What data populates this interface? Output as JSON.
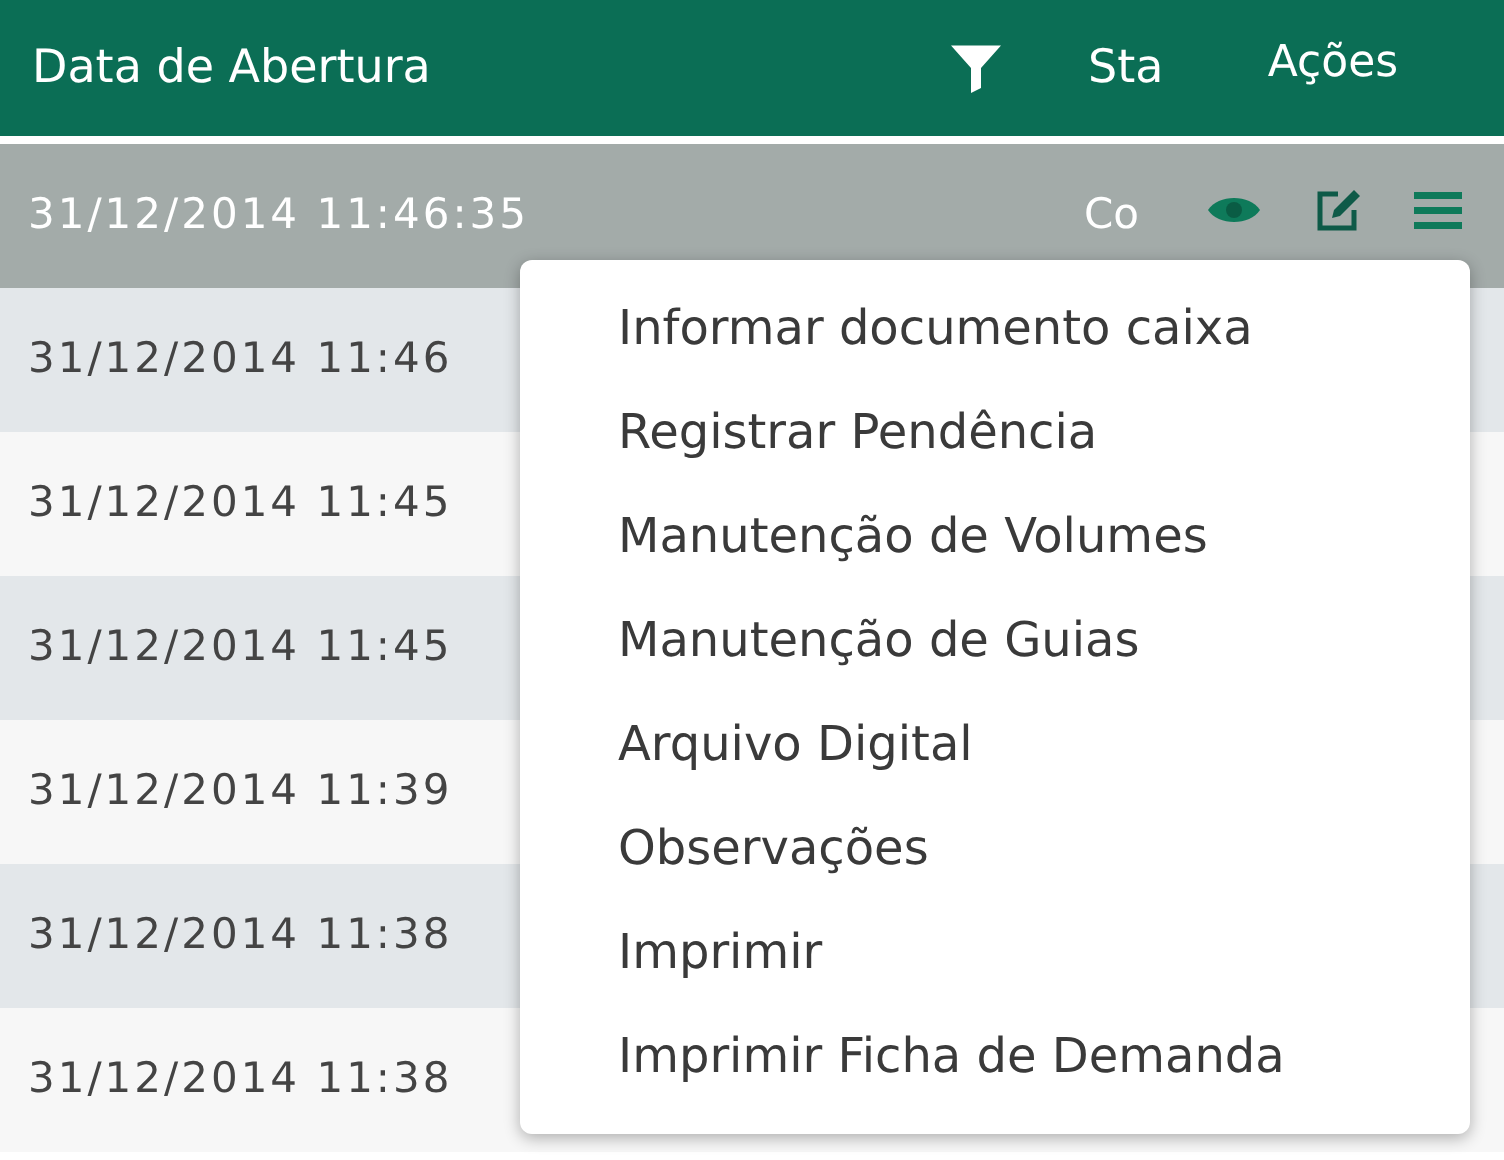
{
  "table": {
    "columns": [
      "Data de Abertura",
      "Sta",
      "Ações"
    ],
    "rows": [
      {
        "date": "31/12/2014 11:46:35",
        "status": "Co",
        "selected": true
      },
      {
        "date": "31/12/2014 11:46",
        "selected": false
      },
      {
        "date": "31/12/2014 11:45",
        "selected": false
      },
      {
        "date": "31/12/2014 11:45",
        "selected": false
      },
      {
        "date": "31/12/2014 11:39",
        "selected": false
      },
      {
        "date": "31/12/2014 11:38",
        "selected": false
      },
      {
        "date": "31/12/2014 11:38",
        "selected": false
      }
    ]
  },
  "context_menu": {
    "items": [
      "Informar documento caixa",
      "Registrar Pendência",
      "Manutenção de Volumes",
      "Manutenção de Guias",
      "Arquivo Digital",
      "Observações",
      "Imprimir",
      "Imprimir Ficha de Demanda"
    ]
  }
}
